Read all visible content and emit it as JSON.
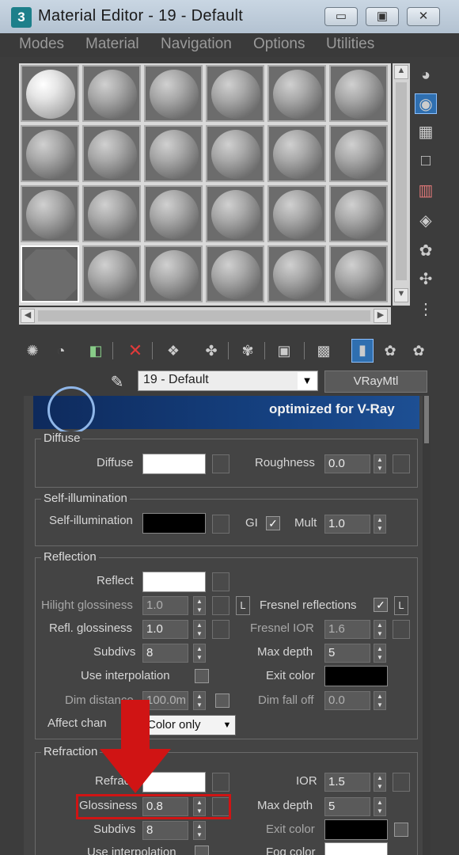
{
  "window": {
    "title": "Material Editor - 19 - Default",
    "app_icon_letter": "3",
    "min_glyph": "▭",
    "max_glyph": "▣",
    "close_glyph": "✕"
  },
  "menu": [
    "Modes",
    "Material",
    "Navigation",
    "Options",
    "Utilities"
  ],
  "slots": {
    "rows": 4,
    "cols": 6,
    "selected_index": 18
  },
  "material": {
    "name": "19 - Default",
    "type": "VRayMtl",
    "dropdown_arrow": "▼"
  },
  "banner": {
    "text": "optimized for V-Ray"
  },
  "diffuse": {
    "group_title": "Diffuse",
    "diffuse_label": "Diffuse",
    "roughness_label": "Roughness",
    "roughness_value": "0.0"
  },
  "self_illumination": {
    "group_title": "Self-illumination",
    "label": "Self-illumination",
    "gi_label": "GI",
    "gi_checked": "✓",
    "mult_label": "Mult",
    "mult_value": "1.0"
  },
  "reflection": {
    "group_title": "Reflection",
    "reflect_label": "Reflect",
    "hilight_label": "Hilight glossiness",
    "hilight_value": "1.0",
    "l_label": "L",
    "fresnel_label": "Fresnel reflections",
    "fresnel_checked": "✓",
    "refl_gloss_label": "Refl. glossiness",
    "refl_gloss_value": "1.0",
    "fresnel_ior_label": "Fresnel IOR",
    "fresnel_ior_value": "1.6",
    "subdivs_label": "Subdivs",
    "subdivs_value": "8",
    "max_depth_label": "Max depth",
    "max_depth_value": "5",
    "use_interp_label": "Use interpolation",
    "exit_color_label": "Exit color",
    "dim_distance_label": "Dim distance",
    "dim_distance_value": "100.0m",
    "dim_falloff_label": "Dim fall off",
    "dim_falloff_value": "0.0",
    "affect_channels_label": "Affect chan",
    "affect_channels_value": "Color only"
  },
  "refraction": {
    "group_title": "Refraction",
    "refract_label": "Refract",
    "ior_label": "IOR",
    "ior_value": "1.5",
    "glossiness_label": "Glossiness",
    "glossiness_value": "0.8",
    "max_depth_label": "Max depth",
    "max_depth_value": "5",
    "subdivs_label": "Subdivs",
    "subdivs_value": "8",
    "exit_color_label": "Exit color",
    "use_interp_label": "Use interpolation",
    "fog_color_label": "Fog color"
  },
  "icons": {
    "right_toolbar": [
      "sample-type-icon",
      "backlight-icon",
      "background-icon",
      "uv-tiling-icon",
      "video-color-check-icon",
      "make-preview-icon",
      "material-options-icon",
      "select-by-material-icon",
      "material-map-navigator-icon"
    ],
    "bottom_toolbar": [
      "get-material-icon",
      "put-to-scene-icon",
      "assign-to-selection-icon",
      "reset-map-icon",
      "make-unique-icon",
      "put-to-library-icon",
      "material-id-channel-icon",
      "show-shaded-icon",
      "show-end-result-icon",
      "go-to-parent-icon",
      "go-forward-icon"
    ]
  },
  "annotation": {
    "color": "#d01414"
  }
}
